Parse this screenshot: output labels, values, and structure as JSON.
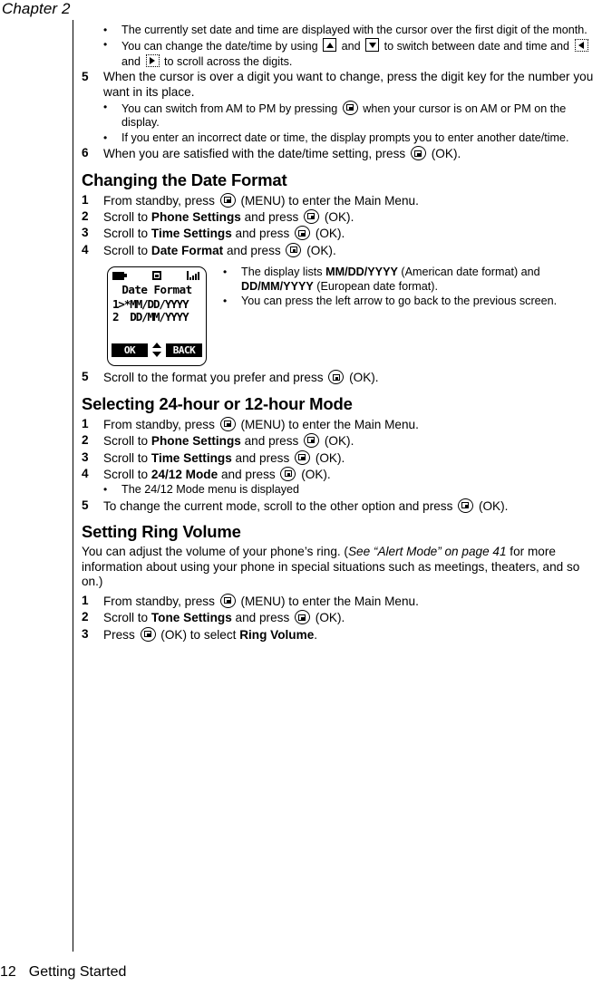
{
  "running_head": "Chapter 2",
  "footer": {
    "page_number": "12",
    "section_name": "Getting Started"
  },
  "icons": {
    "ok_key": "ok-softkey-icon",
    "up_key": "nav-up-icon",
    "down_key": "nav-down-icon",
    "left_key": "nav-left-icon",
    "right_key": "nav-right-icon",
    "battery": "battery-icon",
    "envelope": "message-envelope-icon",
    "signal": "signal-bars-icon"
  },
  "intro_bullets": [
    {
      "dot": "•",
      "pre": "The currently set date and time are displayed with the cursor over the first digit of the month.",
      "post": ""
    },
    {
      "dot": "•",
      "seg1": "You can change the date/time by using ",
      "seg2": " and ",
      "seg3": " to switch between date and time and ",
      "seg4": " and ",
      "seg5": " to scroll across the digits."
    }
  ],
  "step5_date": {
    "num": "5",
    "text": "When the cursor is over a digit you want to change, press the digit key for the number you want in its place."
  },
  "step5_bullets": [
    {
      "dot": "•",
      "seg1": "You can switch from AM to PM by pressing ",
      "seg2": " when your cursor is on AM or PM on the display."
    },
    {
      "dot": "•",
      "seg1": "If you enter an incorrect date or time, the display prompts you to enter another date/time.",
      "seg2": ""
    }
  ],
  "step6_date": {
    "num": "6",
    "seg1": "When you are satisfied with the date/time setting, press ",
    "seg2": " (OK)."
  },
  "section_date_format": {
    "heading": "Changing the Date Format",
    "steps": [
      {
        "num": "1",
        "seg1": "From standby, press ",
        "seg2": " (MENU) to enter the Main Menu."
      },
      {
        "num": "2",
        "seg1": "Scroll to ",
        "bold": "Phone Settings",
        "seg2": " and press ",
        "seg3": " (OK)."
      },
      {
        "num": "3",
        "seg1": "Scroll to ",
        "bold": "Time Settings",
        "seg2": " and press ",
        "seg3": " (OK)."
      },
      {
        "num": "4",
        "seg1": "Scroll to ",
        "bold": "Date Format",
        "seg2": " and press ",
        "seg3": " (OK)."
      }
    ],
    "final_step": {
      "num": "5",
      "seg1": "Scroll to the format you prefer and press ",
      "seg2": " (OK)."
    }
  },
  "phone_display": {
    "title": "Date Format",
    "line1": "1>*MM/DD/YYYY",
    "line2": "2  DD/MM/YYYY",
    "softkey_left": "OK",
    "softkey_right": "BACK"
  },
  "figure_notes": [
    {
      "dot": "•",
      "seg1": "The display lists ",
      "bold1": "MM/DD/YYYY",
      "seg2": " (American date format) and ",
      "bold2": "DD/MM/YYYY",
      "seg3": " (European date format)."
    },
    {
      "dot": "•",
      "seg1": "You can press the left arrow to go back to the previous screen.",
      "bold1": "",
      "seg2": "",
      "bold2": "",
      "seg3": ""
    }
  ],
  "section_24_12": {
    "heading": "Selecting 24-hour or 12-hour Mode",
    "steps": [
      {
        "num": "1",
        "seg1": "From standby, press ",
        "seg2": " (MENU) to enter the Main Menu."
      },
      {
        "num": "2",
        "seg1": "Scroll to ",
        "bold": "Phone Settings",
        "seg2": " and press ",
        "seg3": " (OK)."
      },
      {
        "num": "3",
        "seg1": "Scroll to ",
        "bold": "Time Settings",
        "seg2": " and press ",
        "seg3": " (OK)."
      },
      {
        "num": "4",
        "seg1": "Scroll to ",
        "bold": "24/12 Mode",
        "seg2": " and press ",
        "seg3": " (OK)."
      }
    ],
    "bullet": {
      "dot": "•",
      "text": "The 24/12 Mode menu is displayed"
    },
    "final_step": {
      "num": "5",
      "seg1": "To change the current mode, scroll to the other option and press ",
      "seg2": " (OK)."
    }
  },
  "section_ring_volume": {
    "heading": "Setting Ring Volume",
    "paragraph": {
      "seg1": "You can adjust the volume of your phone’s ring. (",
      "italic": "See “Alert Mode” on page 41",
      "seg2": " for more information about using your phone in special situations such as meetings, theaters, and so on.)"
    },
    "steps": [
      {
        "num": "1",
        "seg1": "From standby, press ",
        "seg2": " (MENU) to enter the Main Menu."
      },
      {
        "num": "2",
        "seg1": "Scroll to ",
        "bold": "Tone Settings",
        "seg2": " and press ",
        "seg3": " (OK)."
      },
      {
        "num": "3",
        "seg1": "Press ",
        "seg2": " (OK) to select ",
        "bold": "Ring Volume",
        "seg3": "."
      }
    ]
  }
}
